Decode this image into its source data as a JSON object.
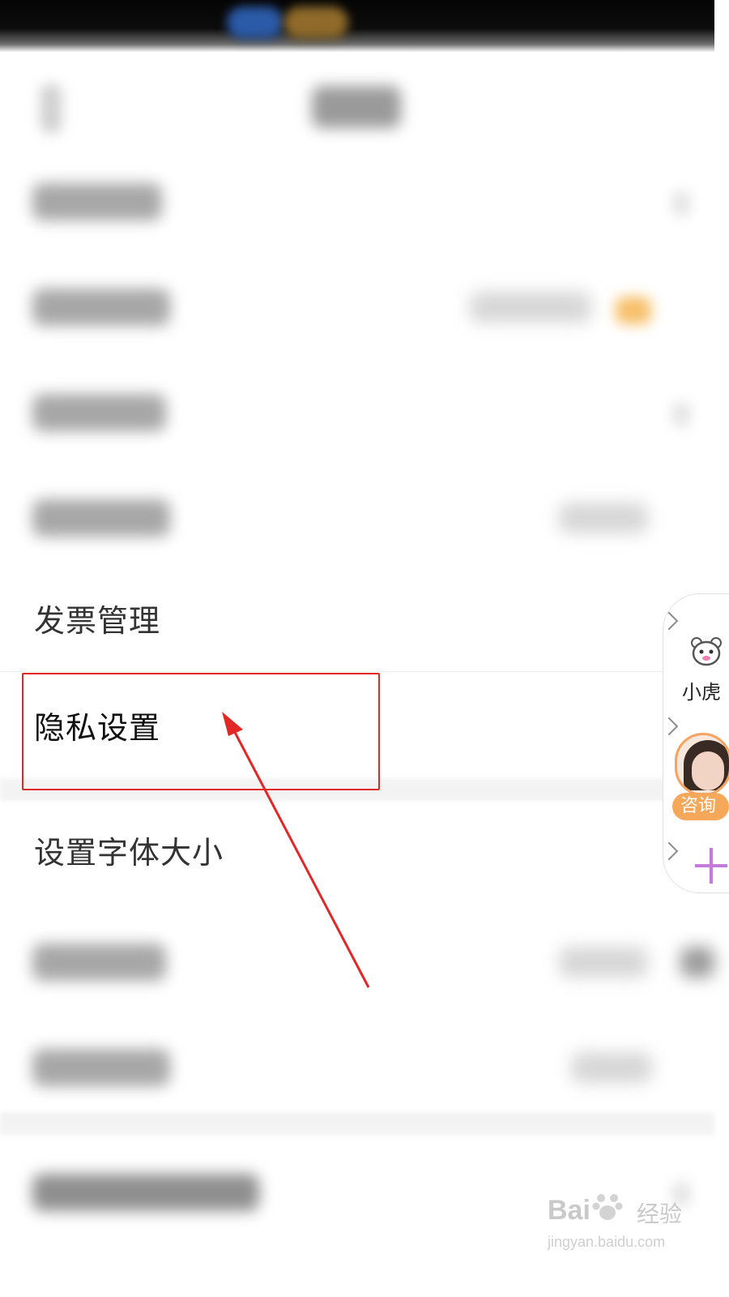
{
  "settings": {
    "items": [
      {
        "label": "发票管理"
      },
      {
        "label": "隐私设置"
      },
      {
        "label": "设置字体大小"
      }
    ]
  },
  "float_panel": {
    "assistant_label": "小虎",
    "consult_label": "咨询"
  },
  "watermark": {
    "brand_left": "Bai",
    "brand_right": "经验",
    "url": "jingyan.baidu.com"
  },
  "colors": {
    "highlight": "#e32626",
    "accent_orange": "#f6a85a",
    "plus_purple": "#c37ad9"
  }
}
